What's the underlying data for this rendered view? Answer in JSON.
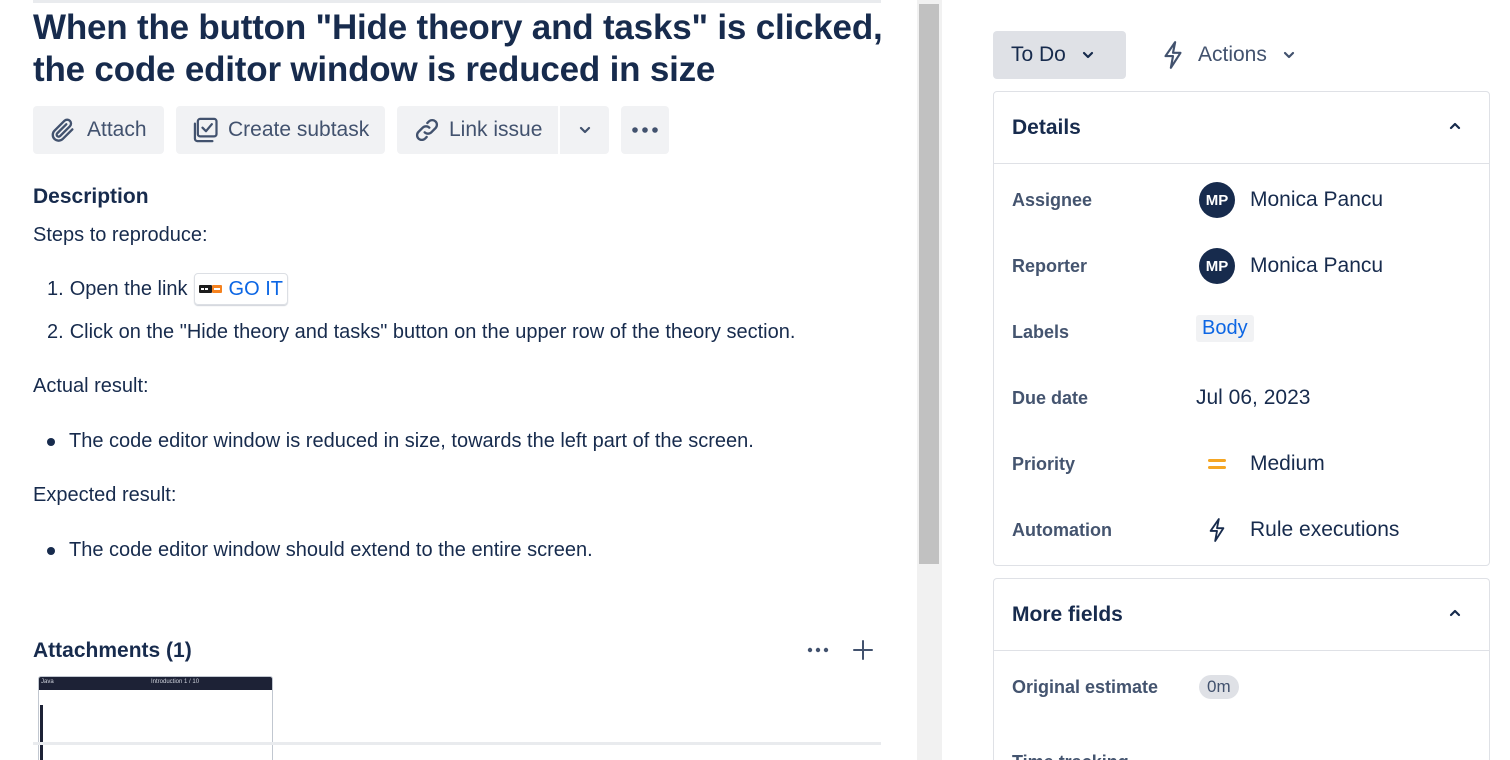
{
  "issue": {
    "title": "When the button \"Hide theory and tasks\" is clicked, the code editor window is reduced in size"
  },
  "toolbar": {
    "attach_label": "Attach",
    "create_subtask_label": "Create subtask",
    "link_issue_label": "Link issue",
    "icons": [
      "paperclip-icon",
      "subtask-icon",
      "link-icon",
      "chevron-down-icon",
      "more-icon"
    ]
  },
  "description": {
    "heading": "Description",
    "steps_heading": "Steps to reproduce:",
    "steps": [
      {
        "number": "1.",
        "text": "Open the link",
        "link_text": "GO IT"
      },
      {
        "number": "2.",
        "text": "Click on the \"Hide theory and tasks\" button on the upper row of the theory section."
      }
    ],
    "actual_heading": "Actual result:",
    "actual_items": [
      "The code editor window is reduced in size, towards the left part of the screen."
    ],
    "expected_heading": "Expected result:",
    "expected_items": [
      "The code editor window should extend to the entire screen."
    ]
  },
  "attachments": {
    "heading": "Attachments (1)",
    "thumbnail": {
      "left_text": "Java",
      "center_text": "Introduction 1 / 10"
    }
  },
  "status": {
    "label": "To Do",
    "actions_label": "Actions"
  },
  "details": {
    "heading": "Details",
    "fields": {
      "assignee": {
        "label": "Assignee",
        "initials": "MP",
        "value": "Monica Pancu"
      },
      "reporter": {
        "label": "Reporter",
        "initials": "MP",
        "value": "Monica Pancu"
      },
      "labels": {
        "label": "Labels",
        "value": "Body"
      },
      "due_date": {
        "label": "Due date",
        "value": "Jul 06, 2023"
      },
      "priority": {
        "label": "Priority",
        "value": "Medium",
        "color": "#f5a623"
      },
      "automation": {
        "label": "Automation",
        "value": "Rule executions"
      }
    }
  },
  "more_fields": {
    "heading": "More fields",
    "original_estimate": {
      "label": "Original estimate",
      "value": "0m"
    },
    "time_tracking": {
      "label": "Time tracking"
    }
  },
  "colors": {
    "text": "#172b4d",
    "link": "#0c66e4",
    "avatar_bg": "#172b4d",
    "button_bg": "#f1f2f4",
    "status_bg": "#dfe1e6"
  }
}
